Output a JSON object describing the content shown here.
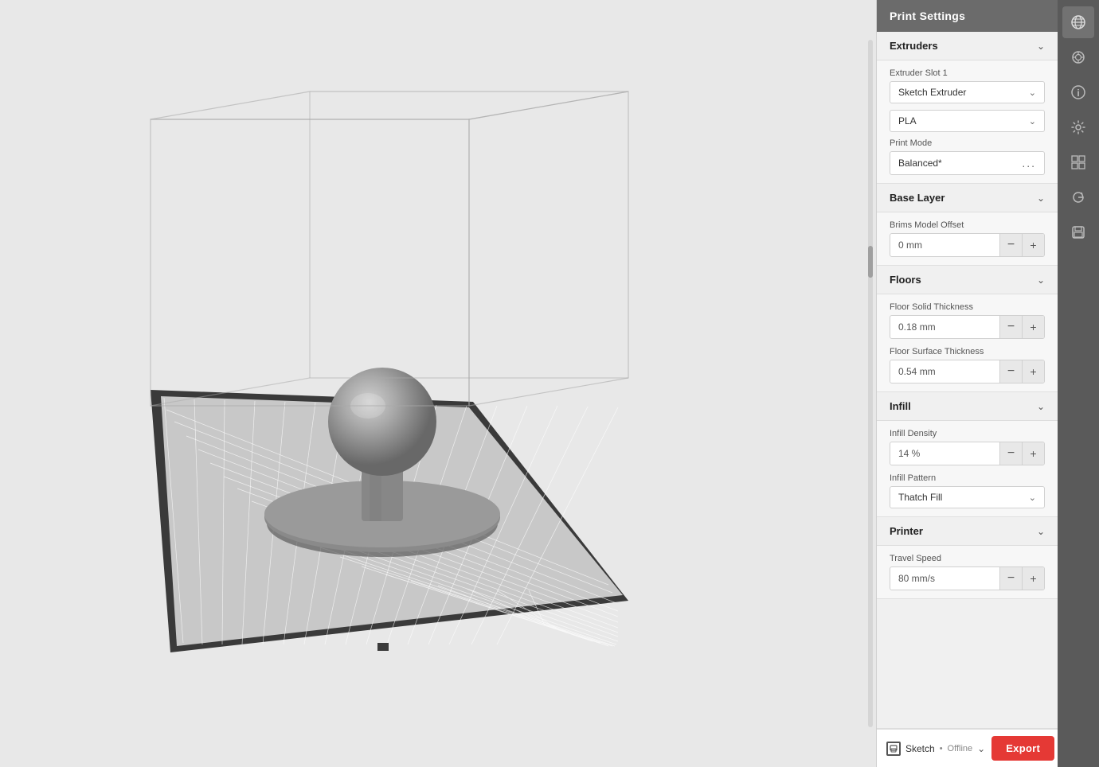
{
  "panel": {
    "title": "Print Settings",
    "sections": {
      "extruders": {
        "label": "Extruders",
        "slot_label": "Extruder Slot 1",
        "extruder_type": "Sketch Extruder",
        "material": "PLA"
      },
      "print_mode": {
        "label": "Print Mode",
        "value": "Balanced*",
        "dots": "..."
      },
      "base_layer": {
        "label": "Base Layer",
        "brims_offset_label": "Brims Model Offset",
        "brims_offset_value": "0 mm"
      },
      "floors": {
        "label": "Floors",
        "floor_solid_label": "Floor Solid Thickness",
        "floor_solid_value": "0.18 mm",
        "floor_surface_label": "Floor Surface Thickness",
        "floor_surface_value": "0.54 mm"
      },
      "infill": {
        "label": "Infill",
        "density_label": "Infill Density",
        "density_value": "14 %",
        "pattern_label": "Infill Pattern",
        "pattern_value": "Thatch Fill"
      },
      "printer": {
        "label": "Printer",
        "travel_speed_label": "Travel Speed",
        "travel_speed_value": "80 mm/s"
      }
    },
    "footer": {
      "printer_name": "Sketch",
      "status": "Offline",
      "separator": "•",
      "export_label": "Export"
    }
  },
  "toolbar": {
    "icons": [
      {
        "name": "globe-icon",
        "symbol": "🌐"
      },
      {
        "name": "layers-icon",
        "symbol": "⚙"
      },
      {
        "name": "info-icon",
        "symbol": "ℹ"
      },
      {
        "name": "settings-icon",
        "symbol": "⚙"
      },
      {
        "name": "grid-icon",
        "symbol": "▦"
      },
      {
        "name": "refresh-icon",
        "symbol": "↻"
      },
      {
        "name": "save-icon",
        "symbol": "💾"
      }
    ]
  }
}
